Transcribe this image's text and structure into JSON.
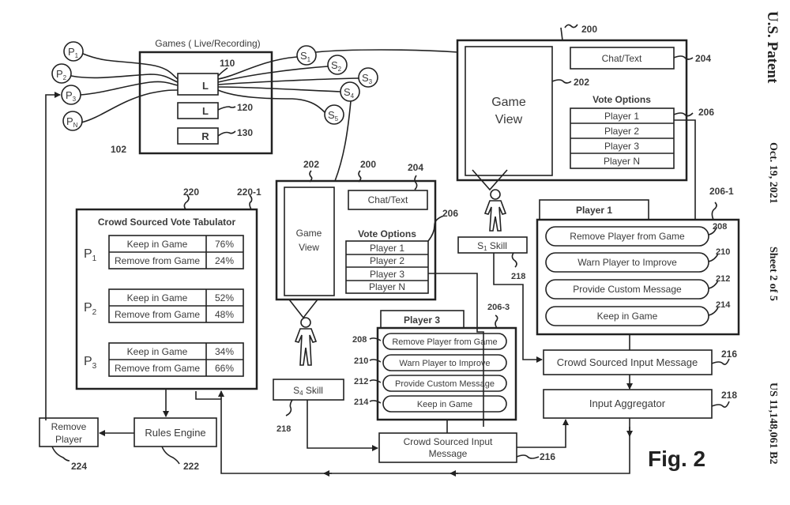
{
  "header": {
    "office": "U.S. Patent",
    "date": "Oct. 19, 2021",
    "sheet": "Sheet 2 of 5",
    "patent_number": "US 11,148,061 B2"
  },
  "figure_label": "Fig. 2",
  "games_panel": {
    "title": "Games ( Live/Recording)",
    "ref": "102",
    "games": [
      {
        "label": "L",
        "ref": "110"
      },
      {
        "label": "L",
        "ref": "120"
      },
      {
        "label": "R",
        "ref": "130"
      }
    ],
    "players": [
      "P1",
      "P2",
      "P3",
      "PN"
    ],
    "spectators": [
      "S1",
      "S2",
      "S3",
      "S4",
      "S5"
    ]
  },
  "spectator_view_top": {
    "ref": "200",
    "game_view": {
      "label": "Game View",
      "ref": "202"
    },
    "chat": {
      "label": "Chat/Text",
      "ref": "204"
    },
    "vote_title": "Vote Options",
    "vote_ref": "206",
    "vote_options": [
      "Player 1",
      "Player 2",
      "Player 3",
      "Player N"
    ]
  },
  "spectator_view_mid": {
    "ref": "200",
    "game_view": {
      "label": "Game View",
      "ref": "202"
    },
    "chat": {
      "label": "Chat/Text",
      "ref": "204"
    },
    "vote_title": "Vote Options",
    "vote_ref": "206",
    "vote_options": [
      "Player 1",
      "Player 2",
      "Player 3",
      "Player N"
    ]
  },
  "skills": [
    {
      "label": "S1 Skill",
      "sub": "1",
      "ref": "218"
    },
    {
      "label": "S4 Skill",
      "sub": "4",
      "ref": "218"
    }
  ],
  "player1_panel": {
    "tab": "Player 1",
    "ref": "206-1",
    "options": [
      {
        "label": "Remove Player from Game",
        "ref": "208"
      },
      {
        "label": "Warn Player to Improve",
        "ref": "210"
      },
      {
        "label": "Provide Custom Message",
        "ref": "212"
      },
      {
        "label": "Keep in Game",
        "ref": "214"
      }
    ]
  },
  "player3_panel": {
    "tab": "Player 3",
    "ref": "206-3",
    "options": [
      {
        "label": "Remove Player from Game",
        "ref": "208"
      },
      {
        "label": "Warn Player to Improve",
        "ref": "210"
      },
      {
        "label": "Provide Custom Message",
        "ref": "212"
      },
      {
        "label": "Keep in Game",
        "ref": "214"
      }
    ]
  },
  "tabulator": {
    "title": "Crowd Sourced Vote Tabulator",
    "ref": "220",
    "ref_inner": "220-1",
    "players": [
      {
        "name": "P",
        "sub": "1",
        "rows": [
          {
            "label": "Keep in Game",
            "value": "76%"
          },
          {
            "label": "Remove from Game",
            "value": "24%"
          }
        ]
      },
      {
        "name": "P",
        "sub": "2",
        "rows": [
          {
            "label": "Keep in Game",
            "value": "52%"
          },
          {
            "label": "Remove from Game",
            "value": "48%"
          }
        ]
      },
      {
        "name": "P",
        "sub": "3",
        "rows": [
          {
            "label": "Keep in Game",
            "value": "34%"
          },
          {
            "label": "Remove from Game",
            "value": "66%"
          }
        ]
      }
    ]
  },
  "crowd_input_right": {
    "label": "Crowd Sourced Input Message",
    "ref": "216"
  },
  "input_aggregator": {
    "label": "Input Aggregator",
    "ref": "218"
  },
  "crowd_input_bottom": {
    "line1": "Crowd Sourced Input",
    "line2": "Message",
    "ref": "216"
  },
  "rules_engine": {
    "label": "Rules Engine",
    "ref": "222"
  },
  "remove_player": {
    "line1": "Remove",
    "line2": "Player",
    "ref": "224"
  }
}
